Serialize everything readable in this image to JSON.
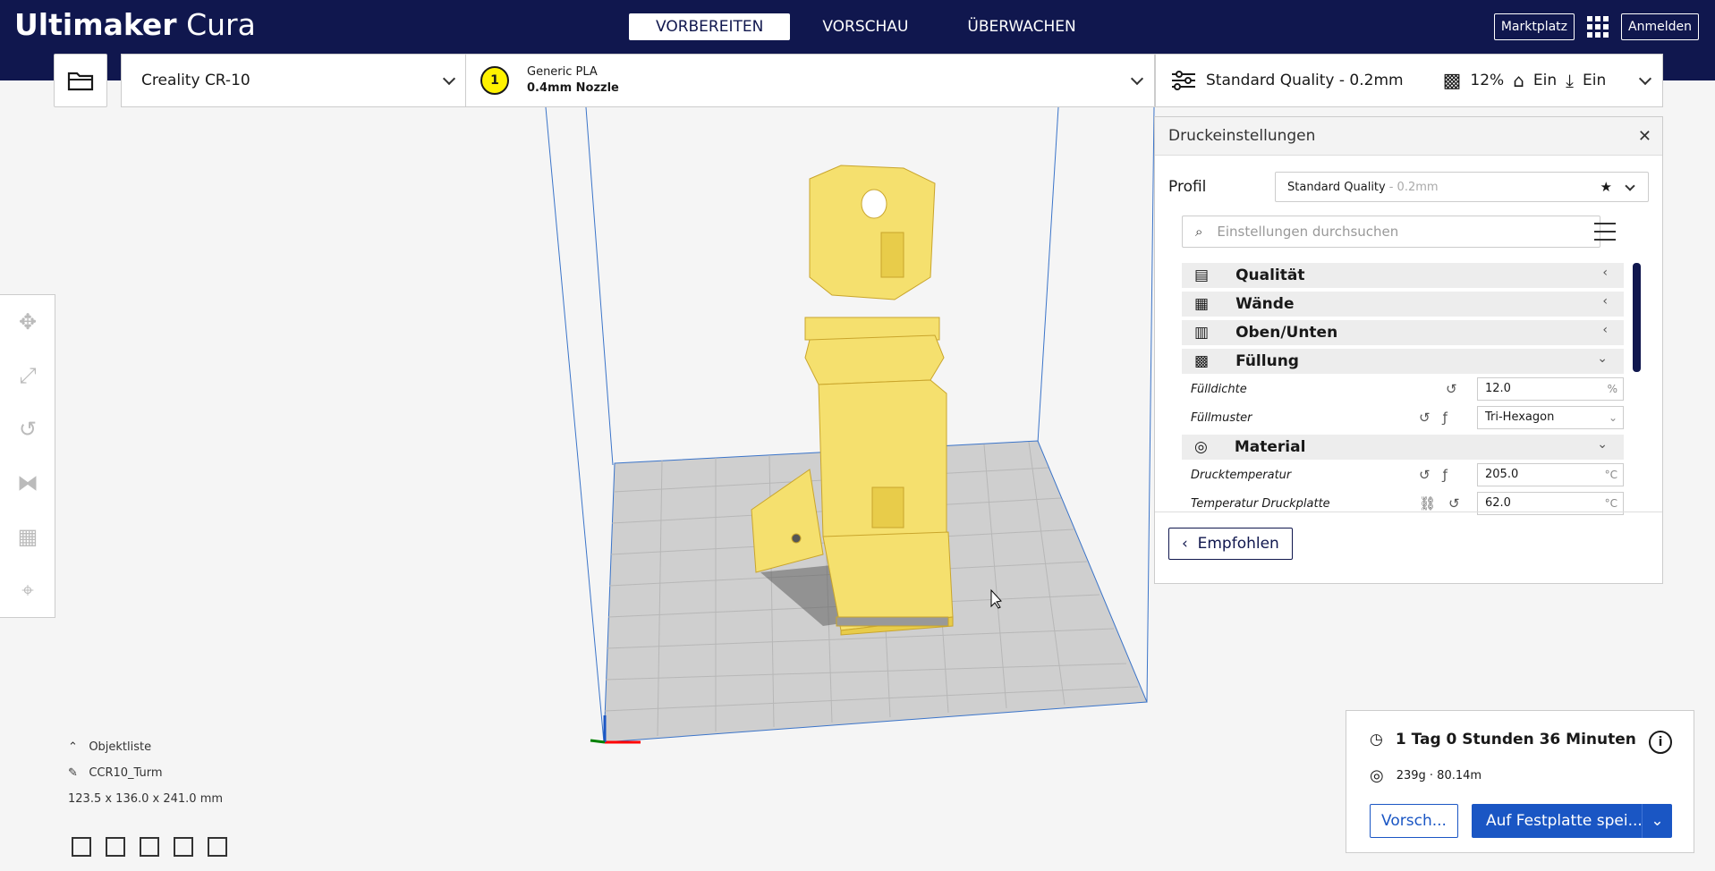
{
  "app": {
    "brand_bold": "Ultimaker",
    "brand_light": "Cura"
  },
  "stages": [
    "VORBEREITEN",
    "VORSCHAU",
    "ÜBERWACHEN"
  ],
  "header": {
    "marketplace": "Marktplatz",
    "signin": "Anmelden"
  },
  "machine": {
    "name": "Creality CR-10"
  },
  "material": {
    "slot": "1",
    "name": "Generic PLA",
    "nozzle": "0.4mm Nozzle",
    "color": "#fff200"
  },
  "quality": {
    "profile": "Standard Quality - 0.2mm",
    "infill": "12%",
    "support": "Ein",
    "adhesion": "Ein"
  },
  "settings": {
    "title": "Druckeinstellungen",
    "profile_label": "Profil",
    "profile_value": "Standard Quality",
    "profile_sub": "- 0.2mm",
    "search_placeholder": "Einstellungen durchsuchen",
    "categories": [
      "Qualität",
      "Wände",
      "Oben/Unten",
      "Füllung",
      "Material"
    ],
    "rows": [
      {
        "label": "Fülldichte",
        "value": "12.0",
        "unit": "%"
      },
      {
        "label": "Füllmuster",
        "value": "Tri-Hexagon",
        "unit": ""
      },
      {
        "label": "Drucktemperatur",
        "value": "205.0",
        "unit": "°C"
      },
      {
        "label": "Temperatur Druckplatte",
        "value": "62.0",
        "unit": "°C"
      }
    ],
    "recommended": "Empfohlen"
  },
  "objects": {
    "header": "Objektliste",
    "name": "CCR10_Turm",
    "dims": "123.5 x 136.0 x 241.0 mm"
  },
  "output": {
    "time": "1 Tag 0 Stunden 36 Minuten",
    "material": "239g · 80.14m",
    "preview": "Vorsch...",
    "save": "Auf Festplatte spei..."
  }
}
